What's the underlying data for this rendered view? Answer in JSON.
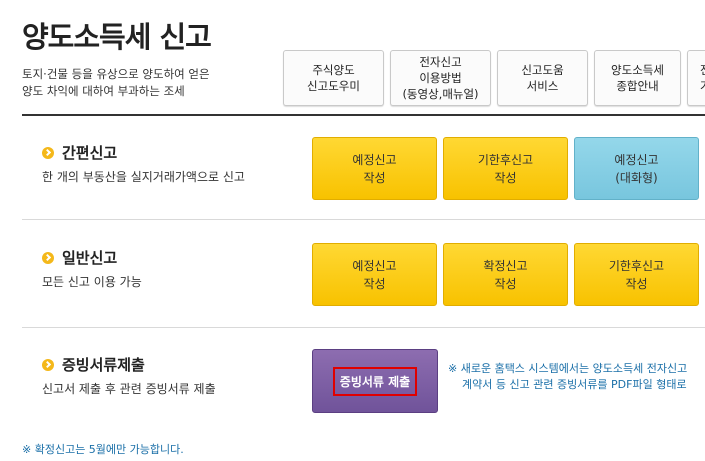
{
  "page": {
    "title": "양도소득세 신고"
  },
  "description": {
    "line1": "토지·건물 등을 유상으로 양도하여 얻은",
    "line2": "양도 차익에 대하여 부과하는 조세"
  },
  "top_buttons": [
    {
      "line1": "주식양도",
      "line2": "신고도우미",
      "line3": ""
    },
    {
      "line1": "전자신고",
      "line2": "이용방법",
      "line3": "(동영상,매뉴얼)"
    },
    {
      "line1": "신고도움",
      "line2": "서비스",
      "line3": ""
    },
    {
      "line1": "양도소득세",
      "line2": "종합안내",
      "line3": ""
    },
    {
      "line1": "전",
      "line2": "가",
      "line3": ""
    }
  ],
  "sections": [
    {
      "title": "간편신고",
      "desc": "한 개의 부동산을 실지거래가액으로 신고",
      "buttons": [
        {
          "line1": "예정신고",
          "line2": "작성"
        },
        {
          "line1": "기한후신고",
          "line2": "작성"
        },
        {
          "line1": "예정신고",
          "line2": "(대화형)"
        }
      ]
    },
    {
      "title": "일반신고",
      "desc": "모든 신고 이용 가능",
      "buttons": [
        {
          "line1": "예정신고",
          "line2": "작성"
        },
        {
          "line1": "확정신고",
          "line2": "작성"
        },
        {
          "line1": "기한후신고",
          "line2": "작성"
        }
      ]
    },
    {
      "title": "증빙서류제출",
      "desc": "신고서 제출 후 관련 증빙서류 제출",
      "button": "증빙서류 제출",
      "note_line1": "※ 새로운 홈택스 시스템에서는 양도소득세 전자신고",
      "note_line2": "계약서 등 신고 관련 증빙서류를 PDF파일 형태로"
    }
  ],
  "footer_note": "※ 확정신고는 5월에만 가능합니다.",
  "colors": {
    "yellow_button": "#fcd11a",
    "blue_button": "#85cfe4",
    "purple_button": "#7b5ea6",
    "highlight_border": "#e00000",
    "note_text": "#1a6fa8"
  }
}
